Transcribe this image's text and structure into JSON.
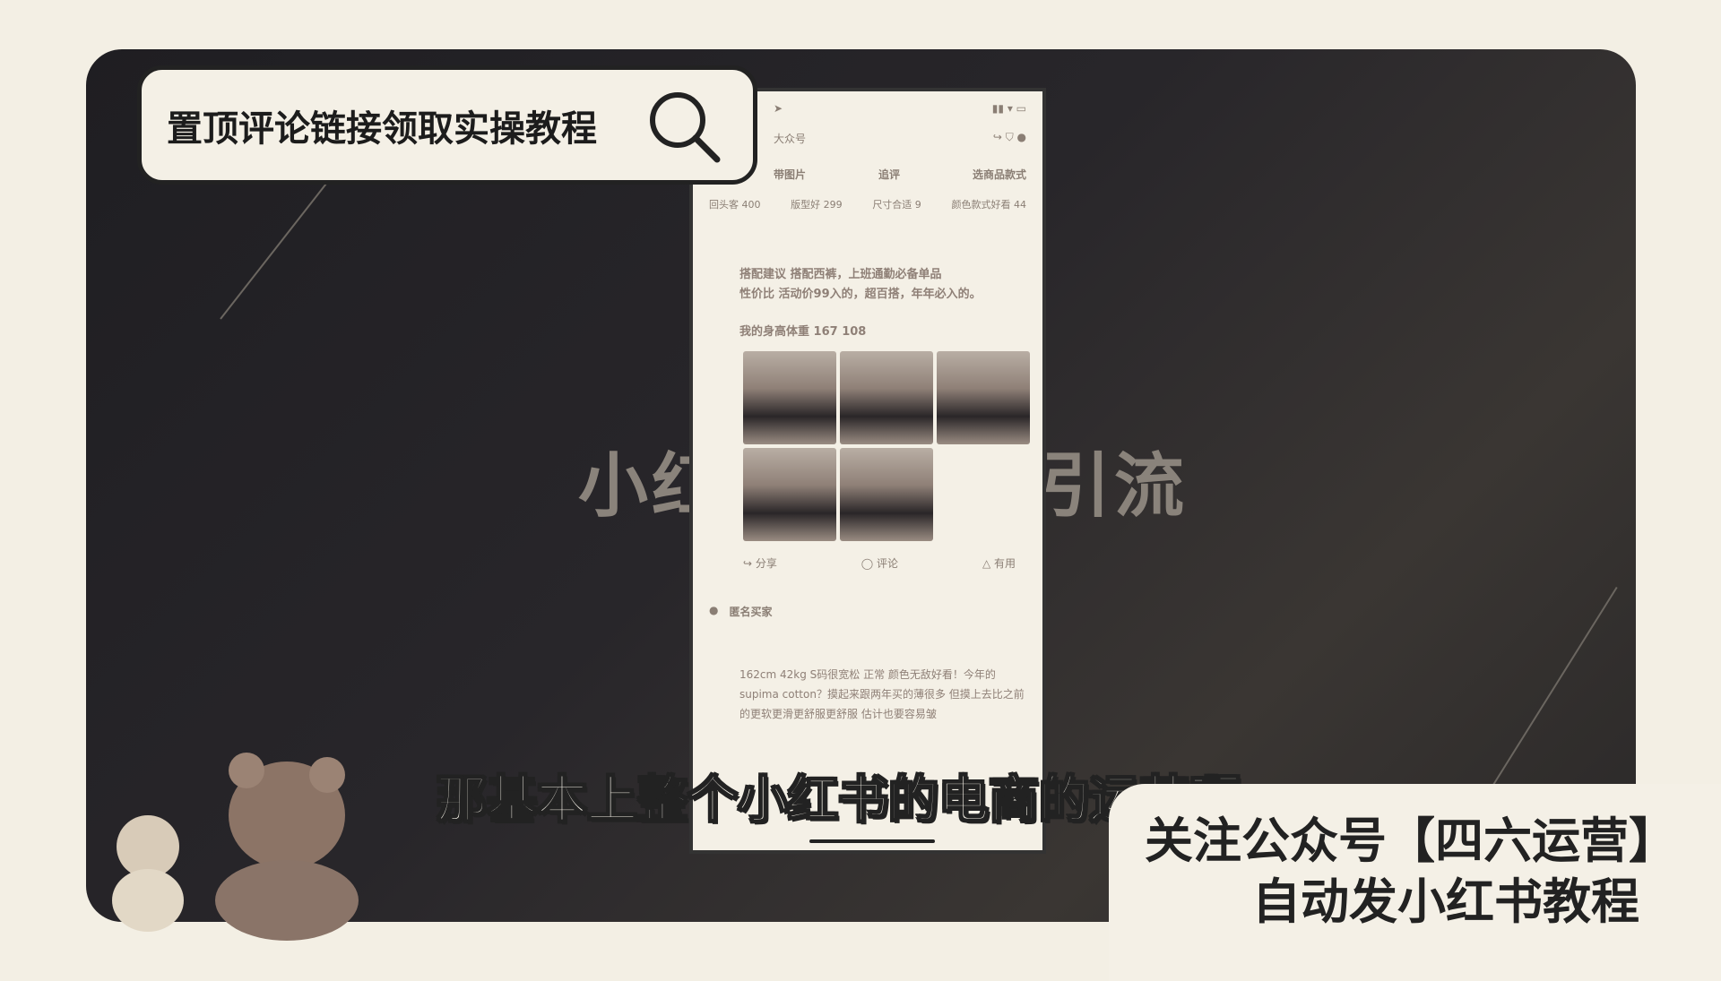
{
  "search_box": {
    "label": "置顶评论链接领取实操教程",
    "icon": "search-icon"
  },
  "background_title": {
    "left": "小红",
    "right": "引流"
  },
  "phone": {
    "nav_title": "大众号",
    "filters": [
      "带图片",
      "追评",
      "选商品款式"
    ],
    "tags": [
      "回头客 400",
      "版型好 299",
      "尺寸合适 9",
      "颜色款式好看 44"
    ],
    "review1": {
      "line1": "搭配建议 搭配西裤，上班通勤必备单品",
      "line2": "性价比 活动价99入的，超百搭，年年必入的。",
      "size_info": "我的身高体重 167 108"
    },
    "actions": [
      "分享",
      "评论",
      "有用"
    ],
    "review2": {
      "user": "匿名买家",
      "text": "162cm 42kg S码很宽松 正常 颜色无敌好看！今年的supima cotton？摸起来跟两年买的薄很多 但摸上去比之前的更软更滑更舒服更舒服 估计也要容易皱"
    }
  },
  "subtitle": "那基本上整个小红书的电商的运营啊",
  "follow_box": {
    "line1": "关注公众号【四六运营】",
    "line2": "自动发小红书教程"
  }
}
